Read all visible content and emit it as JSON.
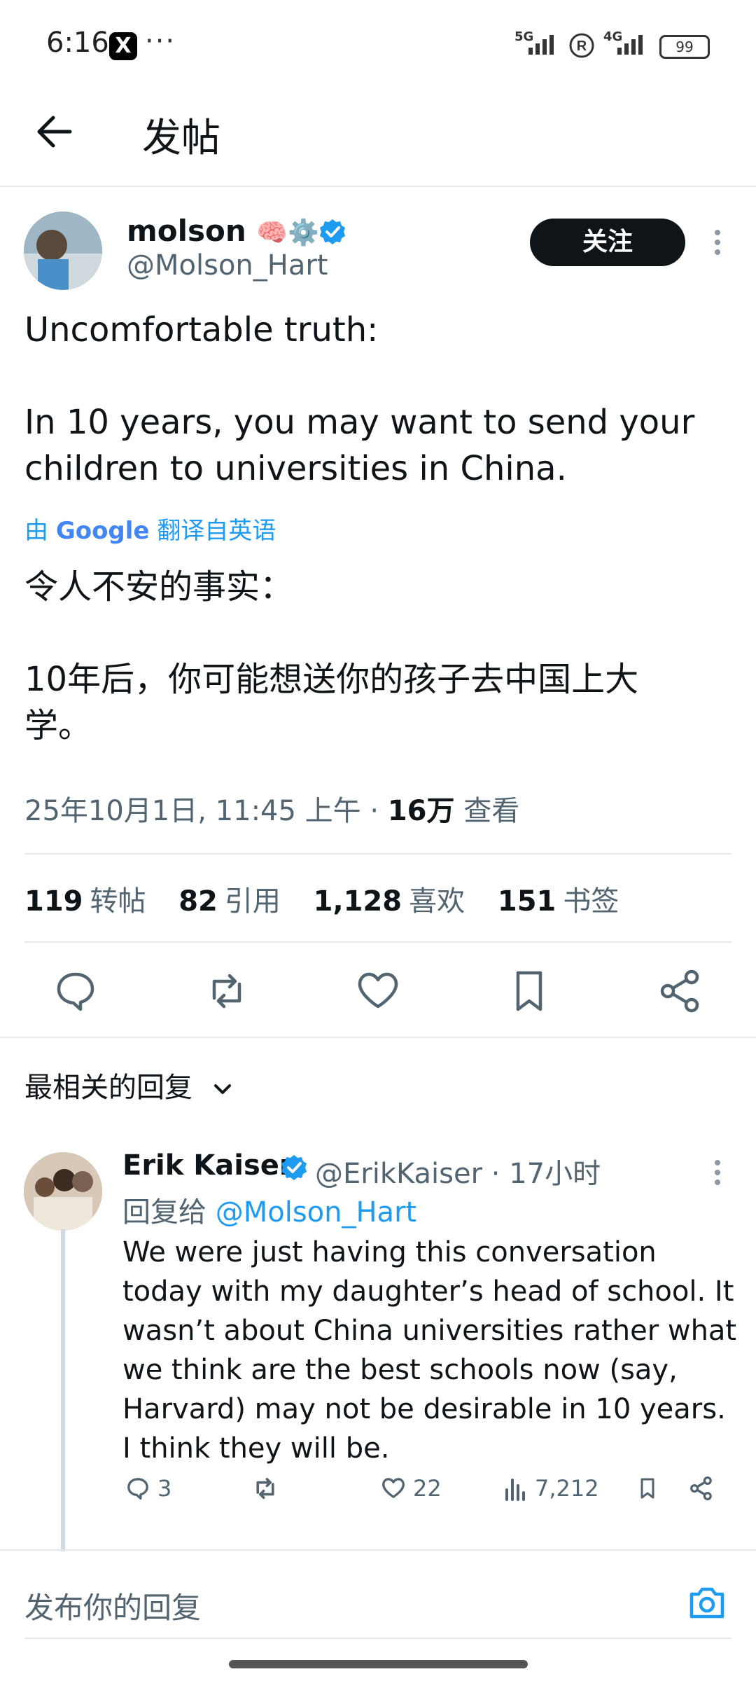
{
  "status_bar": {
    "time": "6:16",
    "x_badge": "X",
    "overflow": "···",
    "net1": "5G",
    "net2": "4G",
    "battery": "99"
  },
  "header": {
    "title": "发帖"
  },
  "tweet": {
    "author_name": "molson",
    "author_emoji": "🧠⚙️",
    "author_handle": "@Molson_Hart",
    "follow_label": "关注",
    "text_en": "Uncomfortable truth:\n\nIn 10 years, you may want to send your children to universities in China.",
    "translate_prefix": "由",
    "translate_brand": "Google",
    "translate_suffix": "翻译自英语",
    "text_zh": "令人不安的事实：\n\n10年后，你可能想送你的孩子去中国上大学。",
    "date_time": "25年10月1日, 11:45 上午 · ",
    "views_count": "16万",
    "views_label": "查看",
    "stats": [
      {
        "num": "119",
        "label": "转帖"
      },
      {
        "num": "82",
        "label": "引用"
      },
      {
        "num": "1,128",
        "label": "喜欢"
      },
      {
        "num": "151",
        "label": "书签"
      }
    ]
  },
  "replies_sort": {
    "label": "最相关的回复"
  },
  "reply": {
    "name": "Erik Kaiser",
    "handle_time": "@ErikKaiser · 17小时",
    "reply_to_prefix": "回复给 ",
    "reply_to_handle": "@Molson_Hart",
    "text": "We were just having this conversation today with my daughter’s head of school. It wasn’t about China universities rather what we think are the best schools now (say, Harvard) may not be desirable in 10 years. I think they will be.",
    "comments": "3",
    "likes": "22",
    "views": "7,212"
  },
  "compose": {
    "placeholder": "发布你的回复"
  },
  "colors": {
    "accent": "#1d9bf0",
    "text": "#0f1419",
    "muted": "#536471"
  }
}
